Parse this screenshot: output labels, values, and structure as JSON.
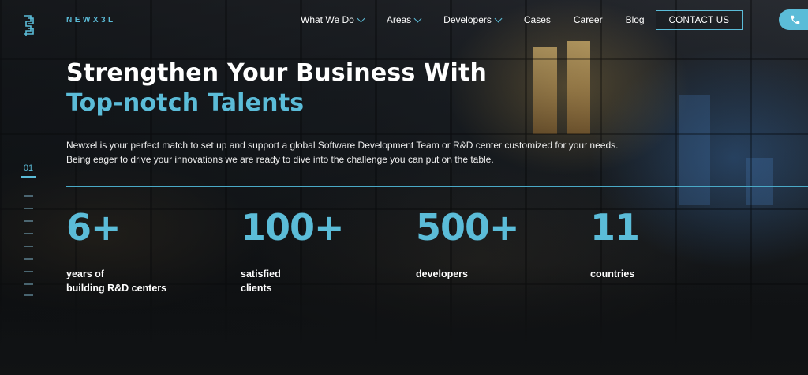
{
  "header": {
    "logo_text": "NEWX3L",
    "nav": [
      {
        "label": "What We Do",
        "dropdown": true
      },
      {
        "label": "Areas",
        "dropdown": true
      },
      {
        "label": "Developers",
        "dropdown": true
      },
      {
        "label": "Cases",
        "dropdown": false
      },
      {
        "label": "Career",
        "dropdown": false
      },
      {
        "label": "Blog",
        "dropdown": false
      }
    ],
    "contact_label": "CONTACT US",
    "phone_icon": "phone-icon"
  },
  "hero": {
    "title_line1": "Strengthen Your Business With",
    "title_line2": "Top-notch Talents",
    "description_line1": "Newxel is your perfect match to set up and support a global Software Development Team or R&D center customized for your needs.",
    "description_line2": "Being eager to drive your innovations we are ready to dive into the challenge you can put on the table."
  },
  "slider": {
    "current": "01"
  },
  "stats": [
    {
      "value": "6+",
      "label_line1": "years of",
      "label_line2": "building R&D centers"
    },
    {
      "value": "100+",
      "label_line1": "satisfied",
      "label_line2": "clients"
    },
    {
      "value": "500+",
      "label_line1": "developers",
      "label_line2": ""
    },
    {
      "value": "11",
      "label_line1": "countries",
      "label_line2": ""
    }
  ],
  "colors": {
    "accent": "#5bbcd8",
    "background": "#14181b",
    "text": "#ffffff"
  }
}
